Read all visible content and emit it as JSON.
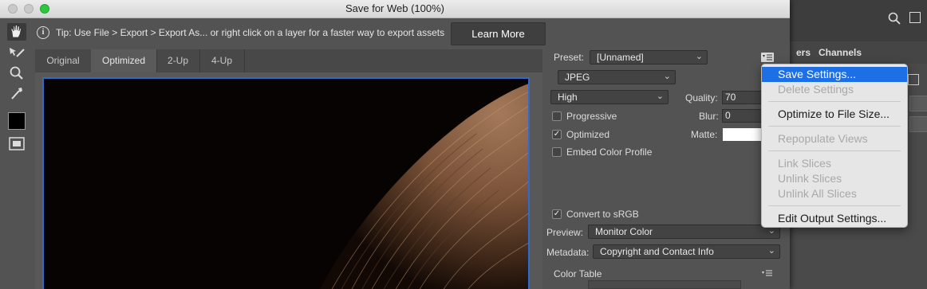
{
  "window": {
    "title": "Save for Web (100%)"
  },
  "tip": {
    "text": "Tip: Use File > Export > Export As...  or right click on a layer for a faster way to export assets",
    "learn_more": "Learn More"
  },
  "tabs": [
    {
      "label": "Original"
    },
    {
      "label": "Optimized"
    },
    {
      "label": "2-Up"
    },
    {
      "label": "4-Up"
    }
  ],
  "settings": {
    "preset_label": "Preset:",
    "preset_value": "[Unnamed]",
    "format_value": "JPEG",
    "quality_level": "High",
    "quality_label": "Quality:",
    "quality_value": "70",
    "blur_label": "Blur:",
    "blur_value": "0",
    "matte_label": "Matte:",
    "progressive_label": "Progressive",
    "progressive_checked": false,
    "optimized_label": "Optimized",
    "optimized_checked": true,
    "embed_label": "Embed Color Profile",
    "embed_checked": false,
    "srgb_label": "Convert to sRGB",
    "srgb_checked": true,
    "preview_label": "Preview:",
    "preview_value": "Monitor Color",
    "metadata_label": "Metadata:",
    "metadata_value": "Copyright and Contact Info",
    "color_table_label": "Color Table"
  },
  "menu": {
    "items": [
      {
        "label": "Save Settings...",
        "enabled": true,
        "highlighted": true
      },
      {
        "label": "Delete Settings",
        "enabled": false
      },
      {
        "label": "Optimize to File Size...",
        "enabled": true
      },
      {
        "label": "Repopulate Views",
        "enabled": false
      },
      {
        "label": "Link Slices",
        "enabled": false
      },
      {
        "label": "Unlink Slices",
        "enabled": false
      },
      {
        "label": "Unlink All Slices",
        "enabled": false
      },
      {
        "label": "Edit Output Settings...",
        "enabled": true
      }
    ]
  },
  "background_app": {
    "tab_partial": "ers",
    "tab_channels": "Channels"
  },
  "colors": {
    "accent": "#1d6fe5",
    "dialog_bg": "#535353",
    "image_border": "#2c6bd0"
  }
}
